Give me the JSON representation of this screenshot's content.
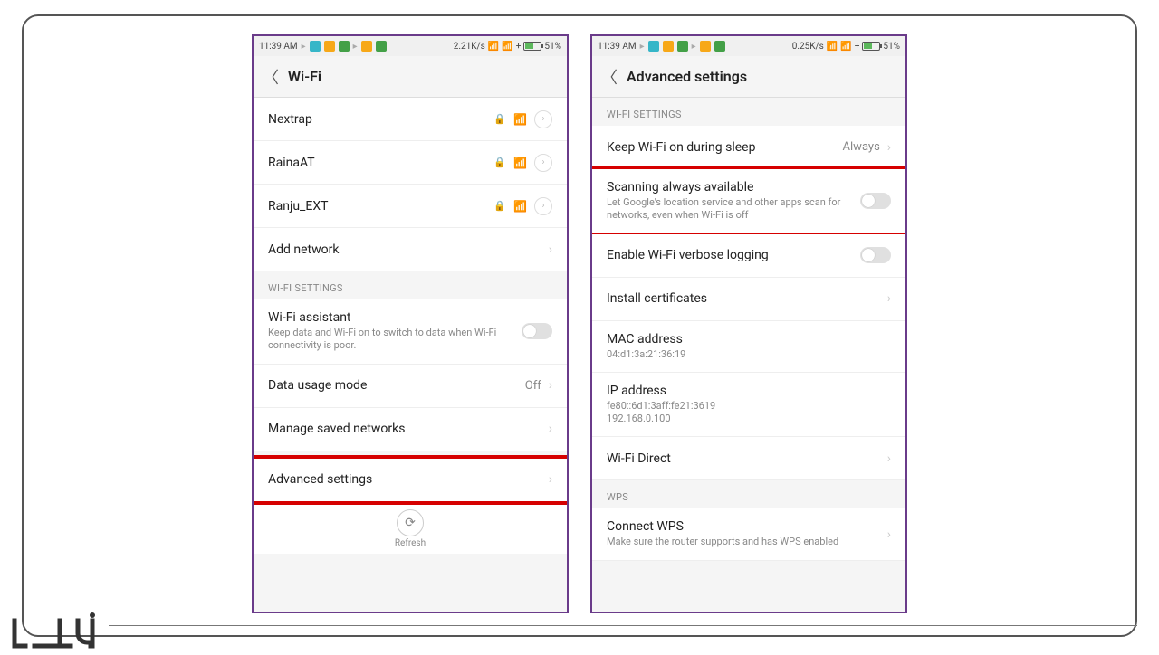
{
  "left": {
    "status": {
      "time": "11:39 AM",
      "speed": "2.21K/s",
      "battery": "51%"
    },
    "title": "Wi-Fi",
    "networks": [
      {
        "name": "Nextrap"
      },
      {
        "name": "RainaAT"
      },
      {
        "name": "Ranju_EXT"
      }
    ],
    "add_network": "Add network",
    "section_hdr": "WI-FI SETTINGS",
    "assistant": {
      "title": "Wi-Fi assistant",
      "sub": "Keep data and Wi-Fi on to switch to data when Wi-Fi connectivity is poor."
    },
    "data_usage": {
      "title": "Data usage mode",
      "value": "Off"
    },
    "manage": "Manage saved networks",
    "advanced": "Advanced settings",
    "refresh": "Refresh"
  },
  "right": {
    "status": {
      "time": "11:39 AM",
      "speed": "0.25K/s",
      "battery": "51%"
    },
    "title": "Advanced settings",
    "section_hdr": "WI-FI SETTINGS",
    "keep_on": {
      "title": "Keep Wi-Fi on during sleep",
      "value": "Always"
    },
    "scanning": {
      "title": "Scanning always available",
      "sub": "Let Google's location service and other apps scan for networks, even when Wi-Fi is off"
    },
    "verbose": "Enable Wi-Fi verbose logging",
    "install": "Install certificates",
    "mac": {
      "title": "MAC address",
      "value": "04:d1:3a:21:36:19"
    },
    "ip": {
      "title": "IP address",
      "value": "fe80::6d1:3aff:fe21:3619\n192.168.0.100"
    },
    "direct": "Wi-Fi Direct",
    "wps_hdr": "WPS",
    "wps": {
      "title": "Connect WPS",
      "sub": "Make sure the router supports and has WPS enabled"
    }
  }
}
